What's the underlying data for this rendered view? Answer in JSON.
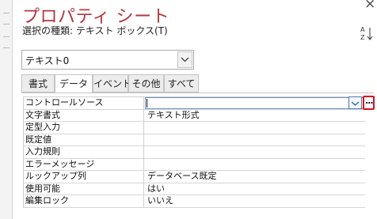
{
  "window": {
    "title": "プロパティ シート",
    "close_label": "×"
  },
  "selection": {
    "label": "選択の種類: テキスト ボックス(T)"
  },
  "object_combo": {
    "value": "テキスト0"
  },
  "tabs": [
    {
      "label": "書式",
      "active": false
    },
    {
      "label": "データ",
      "active": true
    },
    {
      "label": "イベント",
      "active": false
    },
    {
      "label": "その他",
      "active": false
    },
    {
      "label": "すべて",
      "active": false
    }
  ],
  "properties": [
    {
      "name": "コントロールソース",
      "value": ""
    },
    {
      "name": "文字書式",
      "value": "テキスト形式"
    },
    {
      "name": "定型入力",
      "value": ""
    },
    {
      "name": "既定値",
      "value": ""
    },
    {
      "name": "入力規則",
      "value": ""
    },
    {
      "name": "エラーメッセージ",
      "value": ""
    },
    {
      "name": "ルックアップ列",
      "value": "データベース既定"
    },
    {
      "name": "使用可能",
      "value": "はい"
    },
    {
      "name": "編集ロック",
      "value": "いいえ"
    }
  ],
  "builder_button": {
    "label": "..."
  },
  "colors": {
    "title": "#b0373f",
    "highlight_border": "#d6121f",
    "focus_border": "#4a78b5"
  }
}
